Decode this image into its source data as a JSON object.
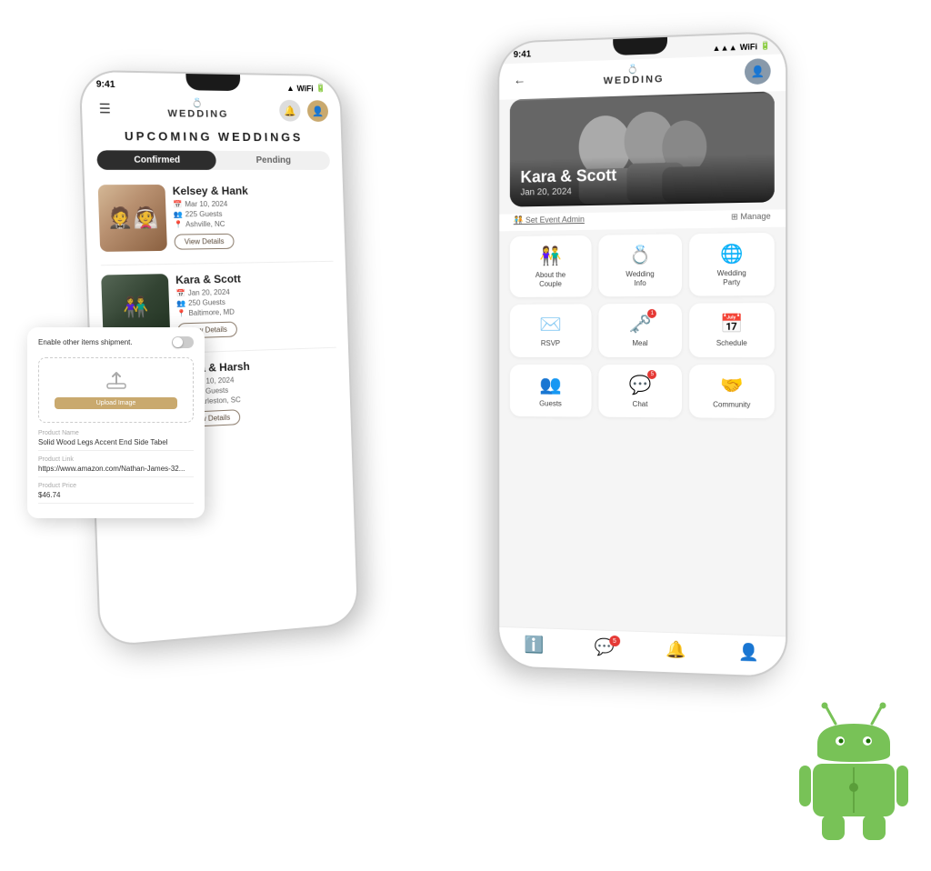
{
  "scene": {
    "background": "#ffffff"
  },
  "phone_left": {
    "status_bar": {
      "time": "9:41",
      "signal": "▲▲▲",
      "wifi": "▼",
      "battery": "█"
    },
    "logo": "WEDDING",
    "page_title": "UPCOMING WEDDINGS",
    "tabs": [
      "Confirmed",
      "Pending"
    ],
    "active_tab": "Confirmed",
    "weddings": [
      {
        "names": "Kelsey & Hank",
        "date": "Mar 10, 2024",
        "guests": "225 Guests",
        "location": "Ashville, NC",
        "btn_label": "View Details"
      },
      {
        "names": "Kara & Scott",
        "date": "Jan 20, 2024",
        "guests": "250 Guests",
        "location": "Baltimore, MD",
        "btn_label": "View Details"
      },
      {
        "names": "Hilna & Harsh",
        "date": "Aug 10, 2024",
        "guests": "300 Guests",
        "location": "Charleston, SC",
        "btn_label": "View Details"
      }
    ]
  },
  "floating_card": {
    "toggle_label": "Enable other items shipment.",
    "upload_btn": "Upload Image",
    "fields": [
      {
        "label": "Product Name",
        "value": "Solid Wood Legs Accent End Side Tabel"
      },
      {
        "label": "Product Link",
        "value": "https://www.amazon.com/Nathan-James-32..."
      },
      {
        "label": "Product Price",
        "value": "$46.74"
      }
    ]
  },
  "phone_right": {
    "status_bar": {
      "time": "9:41",
      "signal": "▲▲▲",
      "wifi": "▼",
      "battery": "█"
    },
    "logo": "WEDDING",
    "hero": {
      "names": "Kara & Scott",
      "date": "Jan 20, 2024"
    },
    "set_admin_label": "🧑‍🤝‍🧑 Set Event Admin",
    "manage_label": "⊞ Manage",
    "menu_items": [
      {
        "icon": "👫",
        "label": "About the\nCouple"
      },
      {
        "icon": "💍",
        "label": "Wedding\nInfo"
      },
      {
        "icon": "🌐",
        "label": "Wedding\nParty"
      },
      {
        "icon": "✉️",
        "label": "RSVP",
        "badge": null
      },
      {
        "icon": "🗝️",
        "label": "Meal",
        "badge": "1"
      },
      {
        "icon": "📅",
        "label": "Schedule"
      },
      {
        "icon": "👥",
        "label": "Guests"
      },
      {
        "icon": "💬",
        "label": "Chat",
        "badge": "5"
      },
      {
        "icon": "🤝",
        "label": "Community"
      }
    ],
    "bottom_nav": [
      {
        "icon": "ℹ️",
        "badge": null
      },
      {
        "icon": "💬",
        "badge": "5"
      },
      {
        "icon": "🔔",
        "badge": null
      },
      {
        "icon": "👤",
        "badge": null
      }
    ]
  },
  "android_robot": {
    "color": "#78c257",
    "dark_color": "#5a9e3a"
  }
}
